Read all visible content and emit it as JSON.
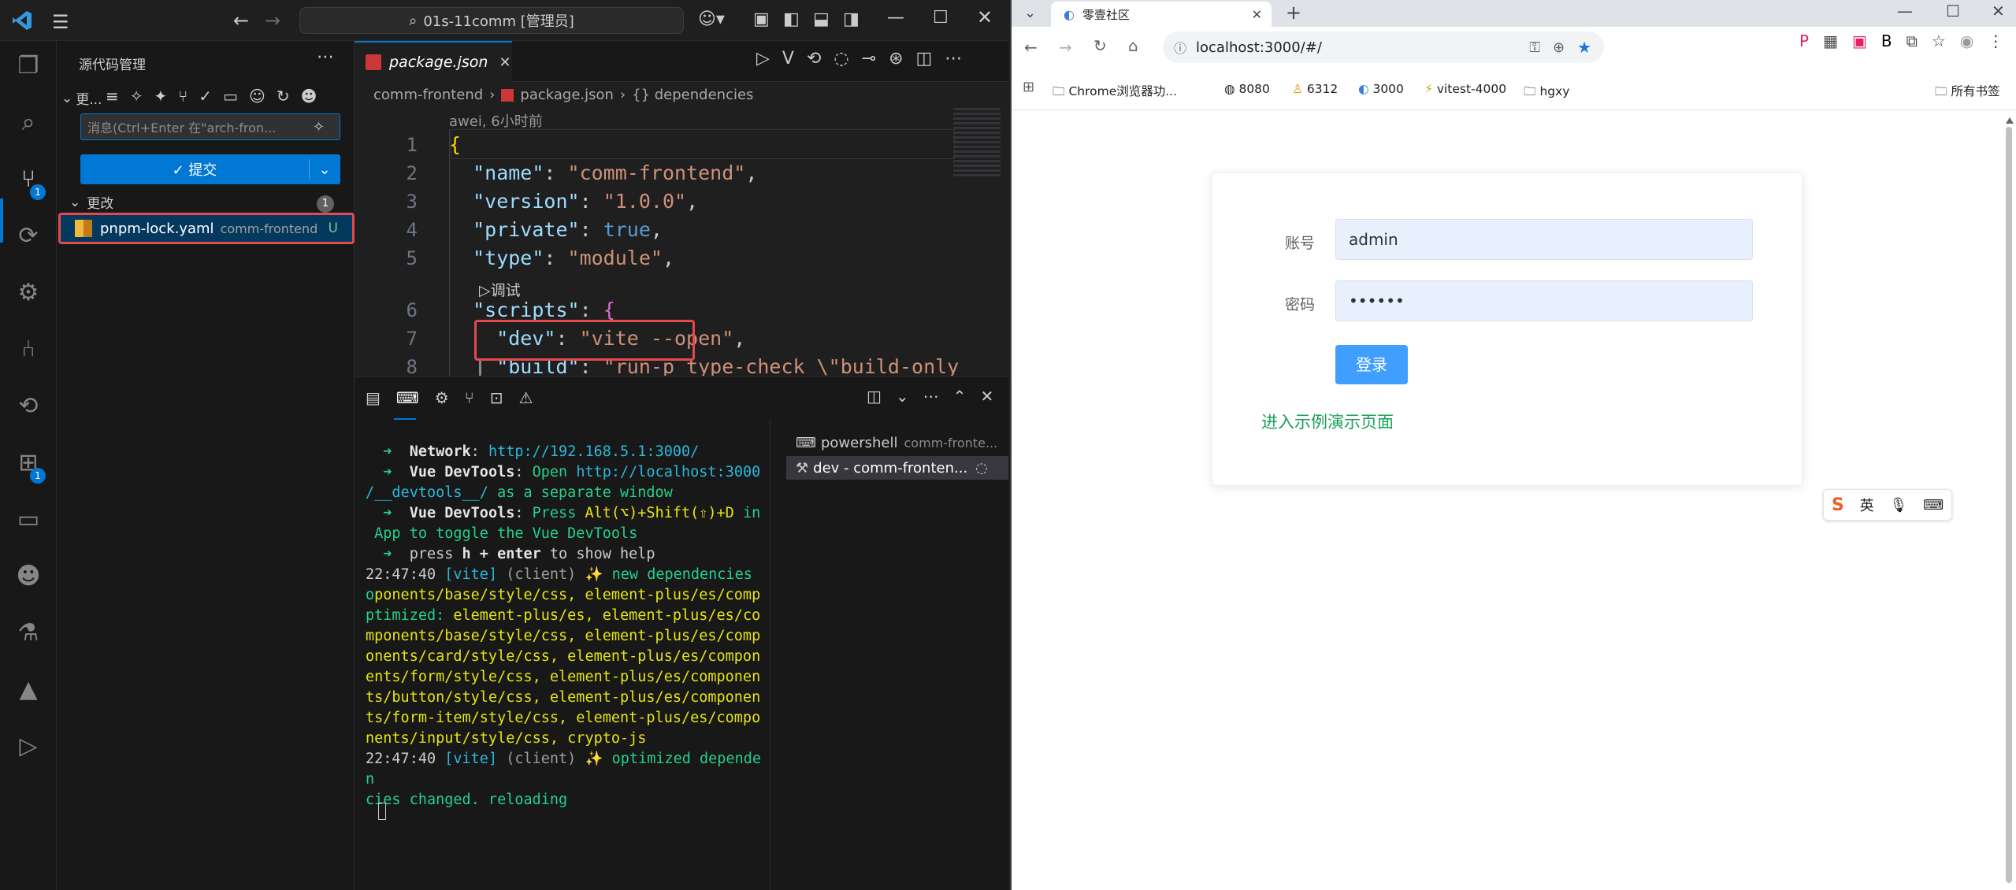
{
  "vscode": {
    "title": "01s-11comm [管理员]",
    "sidebar": {
      "header": "源代码管理",
      "section_short": "更...",
      "commit_placeholder": "消息(Ctrl+Enter 在\"arch-fron...",
      "commit_label": "提交",
      "changes_label": "更改",
      "changes_count": "1",
      "file": {
        "name": "pnpm-lock.yaml",
        "folder": "comm-frontend",
        "status": "U"
      }
    },
    "activity_badges": {
      "scm": "1",
      "extensions": "1"
    },
    "editor": {
      "tab_label": "package.json",
      "breadcrumb": {
        "folder": "comm-frontend",
        "file": "package.json",
        "symbol": "{} dependencies"
      },
      "codelens_blame": "awei, 6小时前",
      "codelens_debug": "▷调试",
      "lines": [
        {
          "no": "1",
          "tokens": [
            {
              "t": "{",
              "c": "tk-brace"
            }
          ]
        },
        {
          "no": "2",
          "tokens": [
            {
              "t": "  \"name\"",
              "c": "tk-key"
            },
            {
              "t": ": ",
              "c": "tk-punc"
            },
            {
              "t": "\"comm-frontend\"",
              "c": "tk-str"
            },
            {
              "t": ",",
              "c": "tk-punc"
            }
          ]
        },
        {
          "no": "3",
          "tokens": [
            {
              "t": "  \"version\"",
              "c": "tk-key"
            },
            {
              "t": ": ",
              "c": "tk-punc"
            },
            {
              "t": "\"1.0.0\"",
              "c": "tk-str"
            },
            {
              "t": ",",
              "c": "tk-punc"
            }
          ]
        },
        {
          "no": "4",
          "tokens": [
            {
              "t": "  \"private\"",
              "c": "tk-key"
            },
            {
              "t": ": ",
              "c": "tk-punc"
            },
            {
              "t": "true",
              "c": "tk-bool"
            },
            {
              "t": ",",
              "c": "tk-punc"
            }
          ]
        },
        {
          "no": "5",
          "tokens": [
            {
              "t": "  \"type\"",
              "c": "tk-key"
            },
            {
              "t": ": ",
              "c": "tk-punc"
            },
            {
              "t": "\"module\"",
              "c": "tk-str"
            },
            {
              "t": ",",
              "c": "tk-punc"
            }
          ]
        },
        {
          "no": "6",
          "tokens": [
            {
              "t": "  \"scripts\"",
              "c": "tk-key"
            },
            {
              "t": ": ",
              "c": "tk-punc"
            },
            {
              "t": "{",
              "c": "tk-brace2"
            }
          ]
        },
        {
          "no": "7",
          "tokens": [
            {
              "t": "    \"dev\"",
              "c": "tk-key"
            },
            {
              "t": ": ",
              "c": "tk-punc"
            },
            {
              "t": "\"vite --open\"",
              "c": "tk-str"
            },
            {
              "t": ",",
              "c": "tk-punc"
            }
          ]
        },
        {
          "no": "8",
          "tokens": [
            {
              "t": "    \"build\"",
              "c": "tk-key"
            },
            {
              "t": ": ",
              "c": "tk-punc"
            },
            {
              "t": "\"run-p type-check \\\"build-only",
              "c": "tk-str"
            }
          ]
        }
      ]
    },
    "terminal": {
      "lines": [
        [
          {
            "t": "  ➜  ",
            "c": "g"
          },
          {
            "t": "Network",
            "c": "w"
          },
          {
            "t": ": ",
            "c": ""
          },
          {
            "t": "http://192.168.5.1:3000/",
            "c": "c"
          }
        ],
        [
          {
            "t": "  ➜  ",
            "c": "g"
          },
          {
            "t": "Vue DevTools",
            "c": "w"
          },
          {
            "t": ": ",
            "c": ""
          },
          {
            "t": "Open ",
            "c": "g"
          },
          {
            "t": "http://localhost:3000",
            "c": "c"
          }
        ],
        [
          {
            "t": "/__devtools__/",
            "c": "c"
          },
          {
            "t": " as a separate window",
            "c": "g"
          }
        ],
        [
          {
            "t": "  ➜  ",
            "c": "g"
          },
          {
            "t": "Vue DevTools",
            "c": "w"
          },
          {
            "t": ": ",
            "c": ""
          },
          {
            "t": "Press ",
            "c": "g"
          },
          {
            "t": "Alt(⌥)+Shift(⇧)+D",
            "c": "y"
          },
          {
            "t": " in",
            "c": "g"
          }
        ],
        [
          {
            "t": " App to toggle the Vue DevTools",
            "c": "g"
          }
        ],
        [
          {
            "t": "  ➜  ",
            "c": "g"
          },
          {
            "t": "press ",
            "c": ""
          },
          {
            "t": "h + enter",
            "c": "w"
          },
          {
            "t": " to show help",
            "c": ""
          }
        ],
        [
          {
            "t": "22:47:40 ",
            "c": ""
          },
          {
            "t": "[vite]",
            "c": "c"
          },
          {
            "t": " (client) ",
            "c": "gr"
          },
          {
            "t": "✨ new dependencies",
            "c": "g"
          }
        ],
        [
          {
            "t": "o",
            "c": "g"
          },
          {
            "t": "ponents/base/style/css, element-plus/es/comp",
            "c": "y"
          }
        ],
        [
          {
            "t": "ptimized: ",
            "c": "g"
          },
          {
            "t": "element-plus/es, element-plus/es/co",
            "c": "y"
          }
        ],
        [
          {
            "t": "mponents/base/style/css, element-plus/es/comp",
            "c": "y"
          }
        ],
        [
          {
            "t": "onents/card/style/css, element-plus/es/compon",
            "c": "y"
          }
        ],
        [
          {
            "t": "ents/form/style/css, element-plus/es/componen",
            "c": "y"
          }
        ],
        [
          {
            "t": "ts/button/style/css, element-plus/es/componen",
            "c": "y"
          }
        ],
        [
          {
            "t": "ts/form-item/style/css, element-plus/es/compo",
            "c": "y"
          }
        ],
        [
          {
            "t": "nents/input/style/css, crypto-js",
            "c": "y"
          }
        ],
        [
          {
            "t": "22:47:40 ",
            "c": ""
          },
          {
            "t": "[vite]",
            "c": "c"
          },
          {
            "t": " (client) ",
            "c": "gr"
          },
          {
            "t": "✨ optimized depende",
            "c": "g"
          }
        ],
        [
          {
            "t": "n",
            "c": "g"
          }
        ],
        [
          {
            "t": "cies changed. reloading",
            "c": "g"
          }
        ]
      ],
      "tabs": [
        {
          "name": "powershell",
          "detail": "comm-fronte..."
        },
        {
          "name": "dev - comm-fronten...",
          "detail": ""
        }
      ]
    }
  },
  "browser": {
    "tab_title": "零壹社区",
    "url": "localhost:3000/#/",
    "bookmarks": [
      "Chrome浏览器功...",
      "8080",
      "6312",
      "3000",
      "vitest-4000",
      "hgxy"
    ],
    "all_bookmarks": "所有书签",
    "login": {
      "account_label": "账号",
      "account_value": "admin",
      "password_label": "密码",
      "password_value": "••••••",
      "login_button": "登录",
      "demo_link": "进入示例演示页面"
    },
    "ime": {
      "english": "英"
    }
  }
}
